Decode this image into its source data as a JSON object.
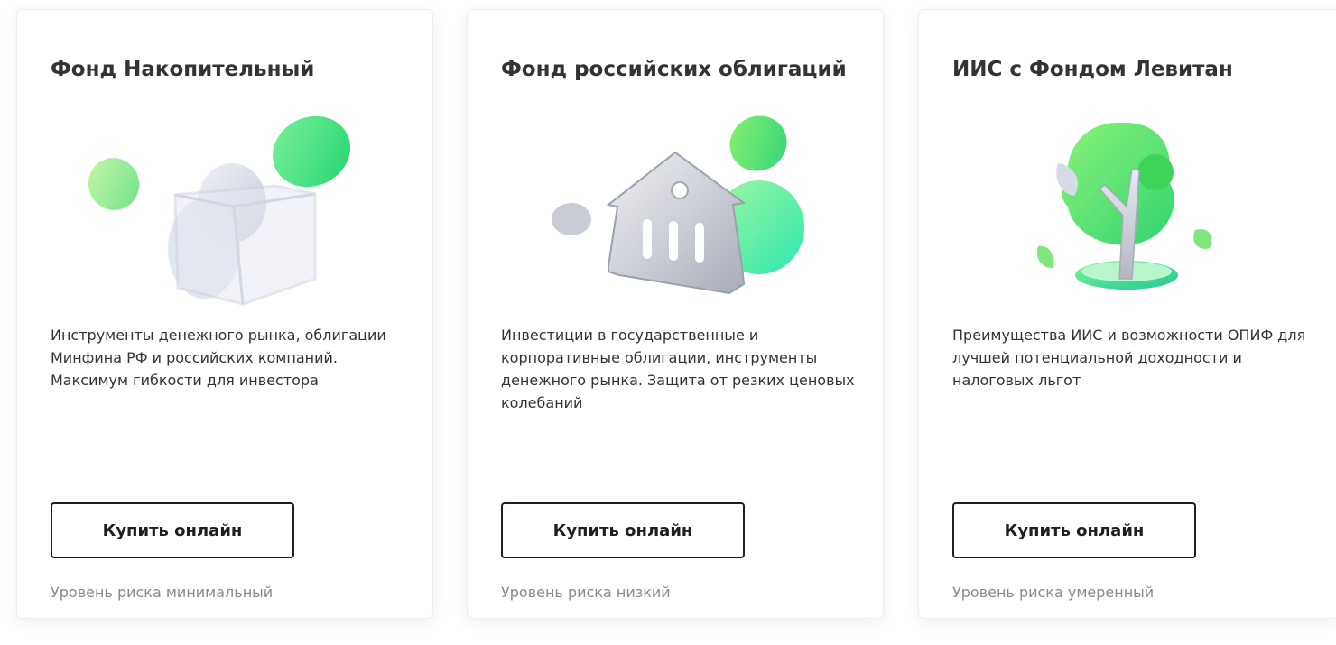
{
  "colors": {
    "accent_green": "#2ee87f",
    "title_text": "#333333",
    "muted_text": "#8a8a8f",
    "button_border": "#1f1f1f"
  },
  "cards": [
    {
      "title": "Фонд Накопительный",
      "illustration_icon": "glass-box-with-coins-icon",
      "description": "Инструменты денежного рынка, облигации Минфина РФ и российских компаний. Максимум гибкости для инвестора",
      "button_label": "Купить онлайн",
      "risk": "Уровень риска минимальный"
    },
    {
      "title": "Фонд российских облигаций",
      "illustration_icon": "bank-building-with-coins-icon",
      "description": "Инвестиции в государственные и корпоративные облигации, инструменты денежного рынка. Защита от резких ценовых колебаний",
      "button_label": "Купить онлайн",
      "risk": "Уровень риска низкий"
    },
    {
      "title": "ИИС с Фондом Левитан",
      "illustration_icon": "tree-with-leaves-icon",
      "description": "Преимущества ИИС и возможности ОПИФ для лучшей потенциальной доходности и налоговых льгот",
      "button_label": "Купить онлайн",
      "risk": "Уровень риска умеренный"
    }
  ]
}
